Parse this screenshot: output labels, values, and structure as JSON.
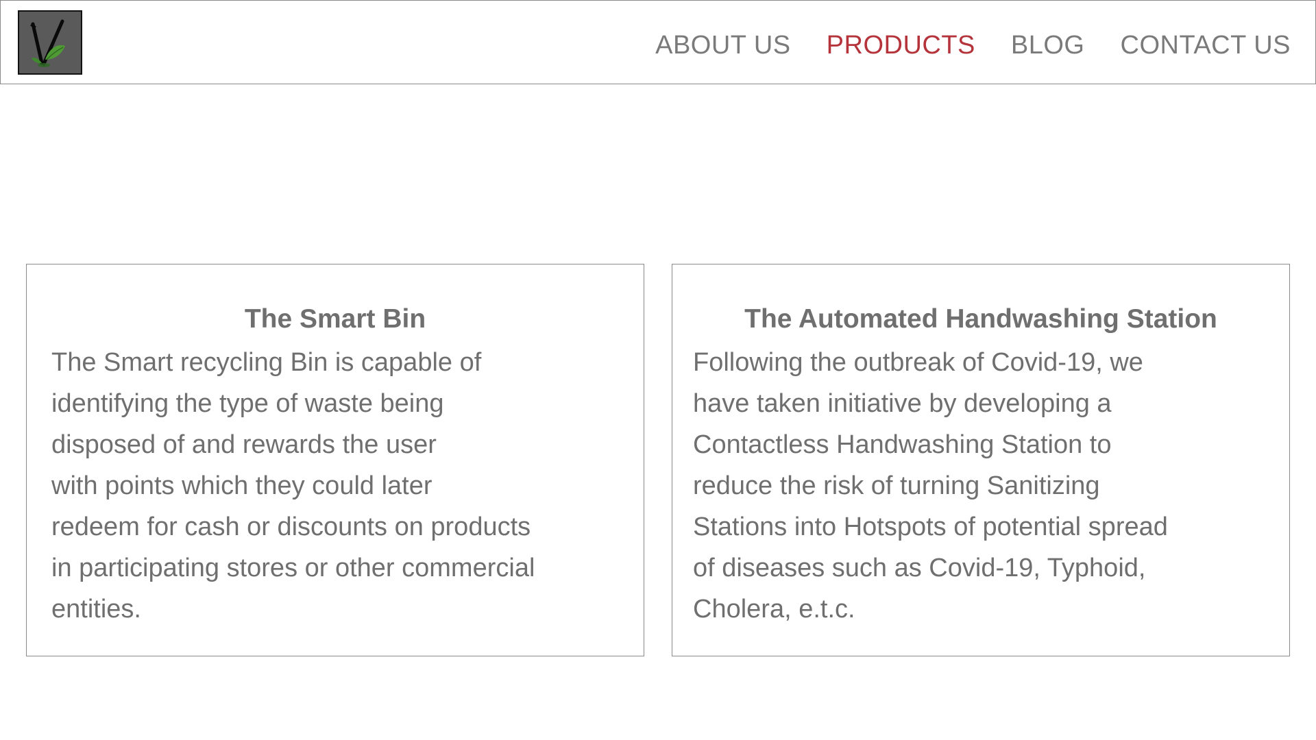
{
  "header": {
    "logo_icon": "plant-logo-icon",
    "nav": [
      {
        "label": "ABOUT US",
        "active": false
      },
      {
        "label": "PRODUCTS",
        "active": true
      },
      {
        "label": "BLOG",
        "active": false
      },
      {
        "label": "CONTACT US",
        "active": false
      }
    ],
    "colors": {
      "nav_text": "#7a7a7a",
      "nav_active": "#b5343c"
    }
  },
  "products": [
    {
      "title": "The Smart Bin",
      "lines": [
        "The Smart recycling Bin is capable of",
        "identifying the type of waste being",
        "disposed of and rewards the user",
        "with points which they could later",
        "redeem for cash or discounts on products",
        "in participating stores or other commercial",
        "entities."
      ]
    },
    {
      "title": "The Automated Handwashing Station",
      "lines": [
        "Following the outbreak of Covid-19, we",
        "have taken initiative by developing a",
        "Contactless Handwashing Station to",
        "reduce the risk of turning Sanitizing",
        "Stations into Hotspots of potential spread",
        "of diseases such as Covid-19, Typhoid,",
        "Cholera, e.t.c."
      ]
    }
  ]
}
